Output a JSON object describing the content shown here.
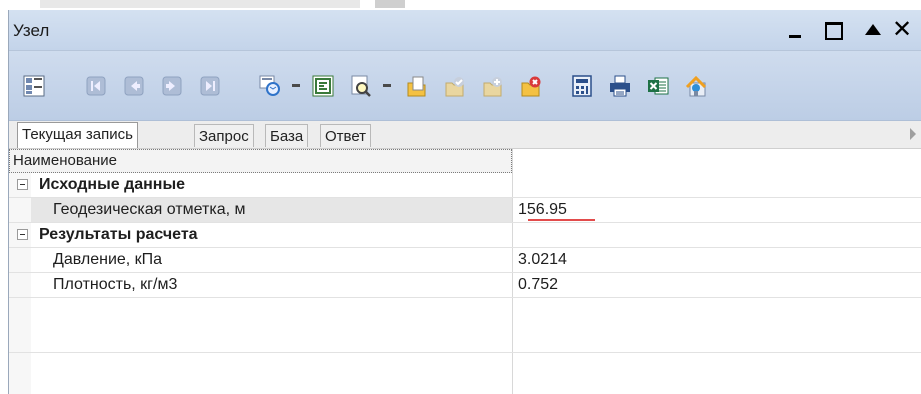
{
  "window": {
    "title": "Узел"
  },
  "toolbar": {
    "icons": [
      "grid-toggle-icon",
      "first-record-icon",
      "prev-record-icon",
      "next-record-icon",
      "last-record-icon",
      "refresh-icon",
      "sync-icon",
      "preview-icon",
      "new-record-icon",
      "apply-icon",
      "add-icon",
      "delete-icon",
      "calculator-icon",
      "print-icon",
      "excel-export-icon",
      "map-icon"
    ]
  },
  "tabs": [
    "Текущая запись",
    "Запрос",
    "База",
    "Ответ"
  ],
  "grid": {
    "header": "Наименование",
    "sections": [
      {
        "title": "Исходные данные",
        "rows": [
          {
            "label": "Геодезическая отметка, м",
            "value": "156.95"
          }
        ]
      },
      {
        "title": "Результаты расчета",
        "rows": [
          {
            "label": "Давление, кПа",
            "value": "3.0214"
          },
          {
            "label": "Плотность, кг/м3",
            "value": "0.752"
          }
        ]
      }
    ]
  },
  "colors": {
    "titlebar": "#c8d7ec",
    "selected_row": "#e6e6e6",
    "edit_underline": "#e24b4b"
  }
}
